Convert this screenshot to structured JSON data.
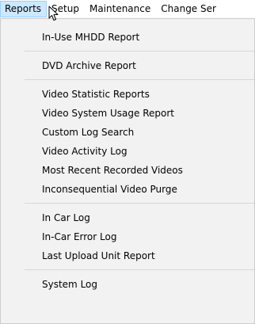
{
  "menubar": {
    "items": [
      {
        "label": "Reports",
        "active": true
      },
      {
        "label": "Setup",
        "active": false
      },
      {
        "label": "Maintenance",
        "active": false
      },
      {
        "label": "Change Ser",
        "active": false
      }
    ]
  },
  "dropdown": {
    "groups": [
      {
        "items": [
          "In-Use MHDD Report"
        ]
      },
      {
        "items": [
          "DVD Archive Report"
        ]
      },
      {
        "items": [
          "Video Statistic Reports",
          "Video System Usage Report",
          "Custom Log Search",
          "Video Activity Log",
          "Most Recent Recorded Videos",
          "Inconsequential Video Purge"
        ]
      },
      {
        "items": [
          "In Car Log",
          "In-Car Error Log",
          "Last Upload Unit Report"
        ]
      },
      {
        "items": [
          "System Log"
        ]
      }
    ]
  },
  "colors": {
    "menu_background": "#f2f2f2",
    "active_highlight": "#cce8ff",
    "active_border": "#99d1ff",
    "separator": "#d7d7d7"
  },
  "icons": {
    "cursor": "arrow-cursor-icon"
  }
}
